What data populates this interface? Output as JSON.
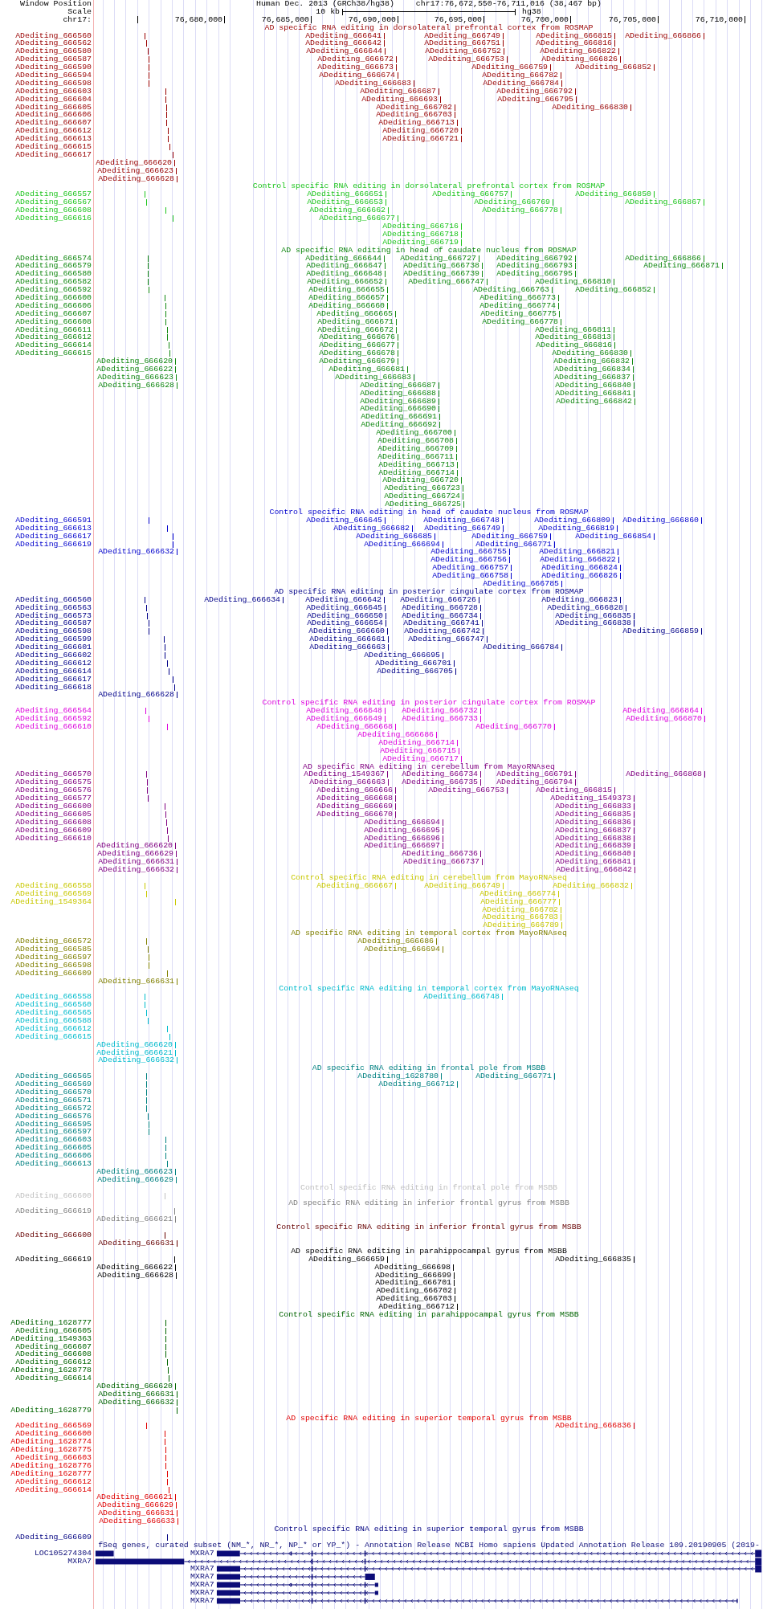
{
  "header": {
    "label": "Window Position",
    "assembly": "Human Dec. 2013 (GRCh38/hg38)",
    "position": "chr17:76,672,550-76,711,016 (38,467 bp)"
  },
  "scale": {
    "label": "Scale",
    "length": "10 kb",
    "assembly": "hg38"
  },
  "ruler": {
    "label": "chr17:",
    "ticks": [
      "76,680,000",
      "76,685,000",
      "76,690,000",
      "76,695,000",
      "76,700,000",
      "76,705,000",
      "76,710,000"
    ]
  },
  "tracks": [
    {
      "title": "AD specific RNA editing in dorsolateral prefrontal cortex from ROSMAP",
      "color": "#990000",
      "rows": [
        {
          "label": "ADediting_666560",
          "items": [
            "ADediting_666641",
            "ADediting_666749",
            "ADediting_666815",
            "ADediting_666866"
          ]
        },
        {
          "label": "ADediting_666562",
          "items": [
            "ADediting_666642",
            "ADediting_666751",
            "ADediting_666816"
          ]
        },
        {
          "label": "ADediting_666580",
          "items": [
            "ADediting_666644",
            "ADediting_666752",
            "ADediting_666822"
          ]
        },
        {
          "label": "ADediting_666587",
          "items": [
            "ADediting_666672",
            "ADediting_666753",
            "ADediting_666826"
          ]
        },
        {
          "label": "ADediting_666590",
          "items": [
            "ADediting_666673",
            "ADediting_666759",
            "ADediting_666852"
          ]
        },
        {
          "label": "ADediting_666594",
          "items": [
            "ADediting_666674",
            "ADediting_666782"
          ]
        },
        {
          "label": "ADediting_666598",
          "items": [
            "ADediting_666683",
            "ADediting_666784"
          ]
        },
        {
          "label": "ADediting_666603",
          "items": [
            "ADediting_666687",
            "ADediting_666792"
          ]
        },
        {
          "label": "ADediting_666604",
          "items": [
            "ADediting_666693",
            "ADediting_666795"
          ]
        },
        {
          "label": "ADediting_666605",
          "items": [
            "ADediting_666702",
            "ADediting_666830"
          ]
        },
        {
          "label": "ADediting_666606",
          "items": [
            "ADediting_666703"
          ]
        },
        {
          "label": "ADediting_666607",
          "items": [
            "ADediting_666713"
          ]
        },
        {
          "label": "ADediting_666612",
          "items": [
            "ADediting_666720"
          ]
        },
        {
          "label": "ADediting_666613",
          "items": [
            "ADediting_666721"
          ]
        },
        {
          "label": "ADediting_666615"
        },
        {
          "label": "ADediting_666617"
        },
        {
          "items": [
            "ADediting_666620"
          ]
        },
        {
          "items": [
            "ADediting_666623"
          ]
        },
        {
          "items": [
            "ADediting_666628"
          ]
        }
      ]
    },
    {
      "title": "Control specific RNA editing in dorsolateral prefrontal cortex from ROSMAP",
      "color": "#1cc41c",
      "rows": [
        {
          "label": "ADediting_666557",
          "items": [
            "ADediting_666651",
            "ADediting_666757",
            "ADediting_666850"
          ]
        },
        {
          "label": "ADediting_666567",
          "items": [
            "ADediting_666653",
            "ADediting_666769",
            "ADediting_666867"
          ]
        },
        {
          "label": "ADediting_666608",
          "items": [
            "ADediting_666662",
            "ADediting_666778"
          ]
        },
        {
          "label": "ADediting_666616",
          "items": [
            "ADediting_666677"
          ]
        },
        {
          "items": [
            "ADediting_666716"
          ]
        },
        {
          "items": [
            "ADediting_666718"
          ]
        },
        {
          "items": [
            "ADediting_666719"
          ]
        }
      ]
    },
    {
      "title": "AD specific RNA editing in head of caudate nucleus from ROSMAP",
      "color": "#118811",
      "rows": [
        {
          "label": "ADediting_666574",
          "items": [
            "ADediting_666644",
            "ADediting_666727",
            "ADediting_666792",
            "ADediting_666866"
          ]
        },
        {
          "label": "ADediting_666579",
          "items": [
            "ADediting_666647",
            "ADediting_666738",
            "ADediting_666793",
            "ADediting_666871"
          ]
        },
        {
          "label": "ADediting_666580",
          "items": [
            "ADediting_666648",
            "ADediting_666739",
            "ADediting_666795"
          ]
        },
        {
          "label": "ADediting_666582",
          "items": [
            "ADediting_666652",
            "ADediting_666747",
            "ADediting_666810"
          ]
        },
        {
          "label": "ADediting_666592",
          "items": [
            "ADediting_666655",
            "ADediting_666763",
            "ADediting_666852"
          ]
        },
        {
          "label": "ADediting_666600",
          "items": [
            "ADediting_666657",
            "ADediting_666773"
          ]
        },
        {
          "label": "ADediting_666606",
          "items": [
            "ADediting_666660",
            "ADediting_666774"
          ]
        },
        {
          "label": "ADediting_666607",
          "items": [
            "ADediting_666665",
            "ADediting_666775"
          ]
        },
        {
          "label": "ADediting_666608",
          "items": [
            "ADediting_666671",
            "ADediting_666778"
          ]
        },
        {
          "label": "ADediting_666611",
          "items": [
            "ADediting_666672",
            "ADediting_666811"
          ]
        },
        {
          "label": "ADediting_666612",
          "items": [
            "ADediting_666676",
            "ADediting_666813"
          ]
        },
        {
          "label": "ADediting_666614",
          "items": [
            "ADediting_666677",
            "ADediting_666816"
          ]
        },
        {
          "label": "ADediting_666615",
          "items": [
            "ADediting_666678",
            "ADediting_666830"
          ]
        },
        {
          "items": [
            "ADediting_666620",
            "ADediting_666679",
            "ADediting_666832"
          ]
        },
        {
          "items": [
            "ADediting_666622",
            "ADediting_666681",
            "ADediting_666834"
          ]
        },
        {
          "items": [
            "ADediting_666623",
            "ADediting_666683",
            "ADediting_666837"
          ]
        },
        {
          "items": [
            "ADediting_666628",
            "ADediting_666687",
            "ADediting_666840"
          ]
        },
        {
          "items": [
            "ADediting_666688",
            "ADediting_666841"
          ]
        },
        {
          "items": [
            "ADediting_666689",
            "ADediting_666842"
          ]
        },
        {
          "items": [
            "ADediting_666690"
          ]
        },
        {
          "items": [
            "ADediting_666691"
          ]
        },
        {
          "items": [
            "ADediting_666692"
          ]
        },
        {
          "items": [
            "ADediting_666700"
          ]
        },
        {
          "items": [
            "ADediting_666708"
          ]
        },
        {
          "items": [
            "ADediting_666709"
          ]
        },
        {
          "items": [
            "ADediting_666711"
          ]
        },
        {
          "items": [
            "ADediting_666713"
          ]
        },
        {
          "items": [
            "ADediting_666714"
          ]
        },
        {
          "items": [
            "ADediting_666720"
          ]
        },
        {
          "items": [
            "ADediting_666723"
          ]
        },
        {
          "items": [
            "ADediting_666724"
          ]
        },
        {
          "items": [
            "ADediting_666725"
          ]
        }
      ]
    },
    {
      "title": "Control specific RNA editing in head of caudate nucleus from ROSMAP",
      "color": "#0000cc",
      "rows": [
        {
          "label": "ADediting_666591",
          "items": [
            "ADediting_666645",
            "ADediting_666748",
            "ADediting_666809",
            "ADediting_666860"
          ]
        },
        {
          "label": "ADediting_666613",
          "items": [
            "ADediting_666682",
            "ADediting_666749",
            "ADediting_666819"
          ]
        },
        {
          "label": "ADediting_666617",
          "items": [
            "ADediting_666685",
            "ADediting_666759",
            "ADediting_666854"
          ]
        },
        {
          "label": "ADediting_666619",
          "items": [
            "ADediting_666694",
            "ADediting_666771"
          ]
        },
        {
          "items": [
            "ADediting_666632",
            "ADediting_666755",
            "ADediting_666821"
          ]
        },
        {
          "items": [
            "ADediting_666756",
            "ADediting_666822"
          ]
        },
        {
          "items": [
            "ADediting_666757",
            "ADediting_666824"
          ]
        },
        {
          "items": [
            "ADediting_666758",
            "ADediting_666826"
          ]
        },
        {
          "items": [
            "ADediting_666785"
          ]
        }
      ]
    },
    {
      "title": "AD specific RNA editing in posterior cingulate cortex from ROSMAP",
      "color": "#000088",
      "rows": [
        {
          "label": "ADediting_666560",
          "items": [
            "ADediting_666634",
            "ADediting_666642",
            "ADediting_666726",
            "ADediting_666823"
          ]
        },
        {
          "label": "ADediting_666563",
          "items": [
            "ADediting_666645",
            "ADediting_666728",
            "ADediting_666828"
          ]
        },
        {
          "label": "ADediting_666573",
          "items": [
            "ADediting_666650",
            "ADediting_666734",
            "ADediting_666835"
          ]
        },
        {
          "label": "ADediting_666587",
          "items": [
            "ADediting_666654",
            "ADediting_666741",
            "ADediting_666838"
          ]
        },
        {
          "label": "ADediting_666598",
          "items": [
            "ADediting_666660",
            "ADediting_666742",
            "ADediting_666859"
          ]
        },
        {
          "label": "ADediting_666599",
          "items": [
            "ADediting_666661",
            "ADediting_666747"
          ]
        },
        {
          "label": "ADediting_666601",
          "items": [
            "ADediting_666663",
            "ADediting_666784"
          ]
        },
        {
          "label": "ADediting_666602",
          "items": [
            "ADediting_666695"
          ]
        },
        {
          "label": "ADediting_666612",
          "items": [
            "ADediting_666701"
          ]
        },
        {
          "label": "ADediting_666614",
          "items": [
            "ADediting_666705"
          ]
        },
        {
          "label": "ADediting_666617"
        },
        {
          "label": "ADediting_666618"
        },
        {
          "items": [
            "ADediting_666628"
          ]
        }
      ]
    },
    {
      "title": "Control specific RNA editing in posterior cingulate cortex from ROSMAP",
      "color": "#dd00dd",
      "rows": [
        {
          "label": "ADediting_666564",
          "items": [
            "ADediting_666648",
            "ADediting_666732",
            "ADediting_666864"
          ]
        },
        {
          "label": "ADediting_666592",
          "items": [
            "ADediting_666649",
            "ADediting_666733",
            "ADediting_666870"
          ]
        },
        {
          "label": "ADediting_666610",
          "items": [
            "ADediting_666668",
            "ADediting_666770"
          ]
        },
        {
          "items": [
            "ADediting_666686"
          ]
        },
        {
          "items": [
            "ADediting_666714"
          ]
        },
        {
          "items": [
            "ADediting_666715"
          ]
        },
        {
          "items": [
            "ADediting_666717"
          ]
        }
      ]
    },
    {
      "title": "AD specific RNA editing in cerebellum from MayoRNAseq",
      "color": "#800080",
      "rows": [
        {
          "label": "ADediting_666570",
          "items": [
            "ADediting_1549367",
            "ADediting_666734",
            "ADediting_666791",
            "ADediting_666868"
          ]
        },
        {
          "label": "ADediting_666575",
          "items": [
            "ADediting_666663",
            "ADediting_666735",
            "ADediting_666794"
          ]
        },
        {
          "label": "ADediting_666576",
          "items": [
            "ADediting_666666",
            "ADediting_666753",
            "ADediting_666815"
          ]
        },
        {
          "label": "ADediting_666577",
          "items": [
            "ADediting_666668",
            "ADediting_1549373"
          ]
        },
        {
          "label": "ADediting_666600",
          "items": [
            "ADediting_666669",
            "ADediting_666833"
          ]
        },
        {
          "label": "ADediting_666605",
          "items": [
            "ADediting_666670",
            "ADediting_666835"
          ]
        },
        {
          "label": "ADediting_666608",
          "items": [
            "ADediting_666694",
            "ADediting_666836"
          ]
        },
        {
          "label": "ADediting_666609",
          "items": [
            "ADediting_666695",
            "ADediting_666837"
          ]
        },
        {
          "label": "ADediting_666610",
          "items": [
            "ADediting_666696",
            "ADediting_666838"
          ]
        },
        {
          "items": [
            "ADediting_666620",
            "ADediting_666697",
            "ADediting_666839"
          ]
        },
        {
          "items": [
            "ADediting_666629",
            "ADediting_666736",
            "ADediting_666840"
          ]
        },
        {
          "items": [
            "ADediting_666631",
            "ADediting_666737",
            "ADediting_666841"
          ]
        },
        {
          "items": [
            "ADediting_666632",
            "ADediting_666842"
          ]
        }
      ]
    },
    {
      "title": "Control specific RNA editing in cerebellum from MayoRNAseq",
      "color": "#c8c800",
      "rows": [
        {
          "label": "ADediting_666558",
          "items": [
            "ADediting_666667",
            "ADediting_666749",
            "ADediting_666832"
          ]
        },
        {
          "label": "ADediting_666569",
          "items": [
            "ADediting_666774"
          ]
        },
        {
          "label": "ADediting_1549364",
          "items": [
            "ADediting_666777"
          ]
        },
        {
          "items": [
            "ADediting_666782"
          ]
        },
        {
          "items": [
            "ADediting_666783"
          ]
        },
        {
          "items": [
            "ADediting_666789"
          ]
        }
      ]
    },
    {
      "title": "AD specific RNA editing in temporal cortex from MayoRNAseq",
      "color": "#808000",
      "rows": [
        {
          "label": "ADediting_666572",
          "items": [
            "ADediting_666686"
          ]
        },
        {
          "label": "ADediting_666585",
          "items": [
            "ADediting_666694"
          ]
        },
        {
          "label": "ADediting_666597"
        },
        {
          "label": "ADediting_666598"
        },
        {
          "label": "ADediting_666609"
        },
        {
          "items": [
            "ADediting_666631"
          ]
        }
      ]
    },
    {
      "title": "Control specific RNA editing in temporal cortex from MayoRNAseq",
      "color": "#00bbcc",
      "rows": [
        {
          "label": "ADediting_666558",
          "items": [
            "ADediting_666748"
          ]
        },
        {
          "label": "ADediting_666560"
        },
        {
          "label": "ADediting_666565"
        },
        {
          "label": "ADediting_666588"
        },
        {
          "label": "ADediting_666612"
        },
        {
          "label": "ADediting_666615"
        },
        {
          "items": [
            "ADediting_666620"
          ]
        },
        {
          "items": [
            "ADediting_666621"
          ]
        },
        {
          "items": [
            "ADediting_666632"
          ]
        }
      ]
    },
    {
      "title": "AD specific RNA editing in frontal pole from MSBB",
      "color": "#008080",
      "rows": [
        {
          "label": "ADediting_666565",
          "items": [
            "ADediting_1628780",
            "ADediting_666771"
          ]
        },
        {
          "label": "ADediting_666569",
          "items": [
            "ADediting_666712"
          ]
        },
        {
          "label": "ADediting_666570"
        },
        {
          "label": "ADediting_666571"
        },
        {
          "label": "ADediting_666572"
        },
        {
          "label": "ADediting_666576"
        },
        {
          "label": "ADediting_666595"
        },
        {
          "label": "ADediting_666597"
        },
        {
          "label": "ADediting_666603"
        },
        {
          "label": "ADediting_666605"
        },
        {
          "label": "ADediting_666606"
        },
        {
          "label": "ADediting_666613"
        },
        {
          "items": [
            "ADediting_666623"
          ]
        },
        {
          "items": [
            "ADediting_666629"
          ]
        }
      ]
    },
    {
      "title": "Control specific RNA editing in frontal pole from MSBB",
      "color": "#c0c0c0",
      "rows": [
        {
          "label": "ADediting_666600"
        }
      ]
    },
    {
      "title": "AD specific RNA editing in inferior frontal gyrus from MSBB",
      "color": "#808080",
      "rows": [
        {
          "label": "ADediting_666619"
        },
        {
          "items": [
            "ADediting_666621"
          ]
        }
      ]
    },
    {
      "title": "Control specific RNA editing in inferior frontal gyrus from MSBB",
      "color": "#660000",
      "rows": [
        {
          "label": "ADediting_666600"
        },
        {
          "items": [
            "ADediting_666631"
          ]
        }
      ]
    },
    {
      "title": "AD specific RNA editing in parahippocampal gyrus from MSBB",
      "color": "#000000",
      "rows": [
        {
          "label": "ADediting_666619",
          "items": [
            "ADediting_666659",
            "ADediting_666835"
          ]
        },
        {
          "items": [
            "ADediting_666622",
            "ADediting_666698"
          ]
        },
        {
          "items": [
            "ADediting_666628",
            "ADediting_666699"
          ]
        },
        {
          "items": [
            "ADediting_666701"
          ]
        },
        {
          "items": [
            "ADediting_666702"
          ]
        },
        {
          "items": [
            "ADediting_666703"
          ]
        },
        {
          "items": [
            "ADediting_666712"
          ]
        }
      ]
    },
    {
      "title": "Control specific RNA editing in parahippocampal gyrus from MSBB",
      "color": "#006400",
      "rows": [
        {
          "label": "ADediting_1628777"
        },
        {
          "label": "ADediting_666605"
        },
        {
          "label": "ADediting_1549363"
        },
        {
          "label": "ADediting_666607"
        },
        {
          "label": "ADediting_666608"
        },
        {
          "label": "ADediting_666612"
        },
        {
          "label": "ADediting_1628778"
        },
        {
          "label": "ADediting_666614"
        },
        {
          "items": [
            "ADediting_666620"
          ]
        },
        {
          "items": [
            "ADediting_666631"
          ]
        },
        {
          "items": [
            "ADediting_666632"
          ]
        },
        {
          "label": "ADediting_1628779"
        }
      ]
    },
    {
      "title": "AD specific RNA editing in superior temporal gyrus from MSBB",
      "color": "#e00000",
      "rows": [
        {
          "label": "ADediting_666569",
          "items": [
            "ADediting_666836"
          ]
        },
        {
          "label": "ADediting_666600"
        },
        {
          "label": "ADediting_1628774"
        },
        {
          "label": "ADediting_1628775"
        },
        {
          "label": "ADediting_666603"
        },
        {
          "label": "ADediting_1628776"
        },
        {
          "label": "ADediting_1628777"
        },
        {
          "label": "ADediting_666612"
        },
        {
          "label": "ADediting_666614"
        },
        {
          "items": [
            "ADediting_666621"
          ]
        },
        {
          "items": [
            "ADediting_666629"
          ]
        },
        {
          "items": [
            "ADediting_666631"
          ]
        },
        {
          "items": [
            "ADediting_666633"
          ]
        }
      ]
    },
    {
      "title": "Control specific RNA editing in superior temporal gyrus from MSBB",
      "color": "#000080",
      "rows": [
        {
          "label": "ADediting_666609"
        }
      ]
    }
  ],
  "genes": {
    "title": "fSeq genes, curated subset (NM_*, NR_*, NP_* or YP_*) - Annotation Release NCBI Homo sapiens Updated Annotation Release 109.20190905 (2019-",
    "color": "#0c0c78",
    "rows": [
      {
        "label": "LOC105274304",
        "kind": "stub",
        "items": [
          {
            "name": "MXRA7",
            "kind": "extended"
          }
        ]
      },
      {
        "label": "MXRA7",
        "kind": "long"
      },
      {
        "items": [
          {
            "name": "MXRA7",
            "kind": "full"
          }
        ]
      },
      {
        "items": [
          {
            "name": "MXRA7",
            "kind": "short"
          }
        ]
      },
      {
        "items": [
          {
            "name": "MXRA7",
            "kind": "medium"
          }
        ]
      },
      {
        "items": [
          {
            "name": "MXRA7",
            "kind": "mid"
          }
        ]
      },
      {
        "items": [
          {
            "name": "MXRA7",
            "kind": "tail"
          }
        ]
      }
    ]
  }
}
